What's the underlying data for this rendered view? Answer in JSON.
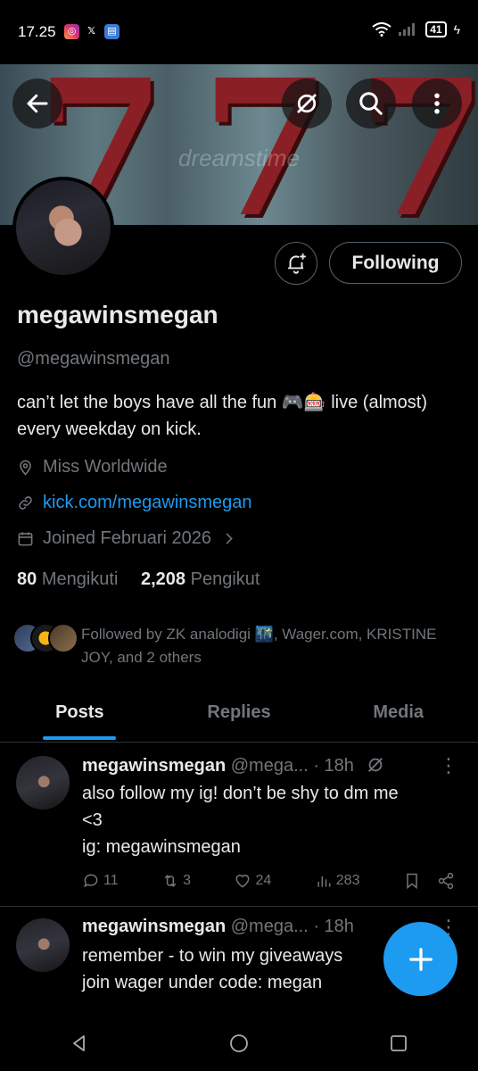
{
  "status_bar": {
    "time": "17.25",
    "battery": "41",
    "notif_icons": [
      "instagram-icon",
      "x-icon",
      "messages-icon"
    ]
  },
  "banner": {
    "watermark": "dreamstime"
  },
  "header_buttons": [
    "back-arrow-icon",
    "grok-icon",
    "search-icon",
    "more-vertical-icon"
  ],
  "profile": {
    "follow_label": "Following",
    "name": "megawinsmegan",
    "handle": "@megawinsmegan",
    "bio": "can’t let the boys have all the fun 🎮🎰 live (almost) every weekday on kick.",
    "location": "Miss Worldwide",
    "link": "kick.com/megawinsmegan",
    "joined": "Joined Februari 2026",
    "following_count": "80",
    "following_label": "Mengikuti",
    "followers_count": "2,208",
    "followers_label": "Pengikut",
    "followed_by": "Followed by ZK analodigi 🌃, Wager.com, KRISTINE JOY, and 2 others"
  },
  "tabs": [
    {
      "label": "Posts",
      "active": true
    },
    {
      "label": "Replies",
      "active": false
    },
    {
      "label": "Media",
      "active": false
    }
  ],
  "posts": [
    {
      "name": "megawinsmegan",
      "handle": "@mega...",
      "time": "· 18h",
      "lines": [
        "also follow my ig! don’t be shy to dm me",
        "<3",
        "ig: megawinsmegan"
      ],
      "replies": "11",
      "reposts": "3",
      "likes": "24",
      "views": "283"
    },
    {
      "name": "megawinsmegan",
      "handle": "@mega...",
      "time": "· 18h",
      "lines": [
        "remember - to win my giveaways",
        "join wager under code: megan"
      ]
    }
  ],
  "colors": {
    "accent": "#1d9bf0",
    "background": "#000000",
    "secondary_text": "#71767b",
    "border": "#2f3336"
  }
}
